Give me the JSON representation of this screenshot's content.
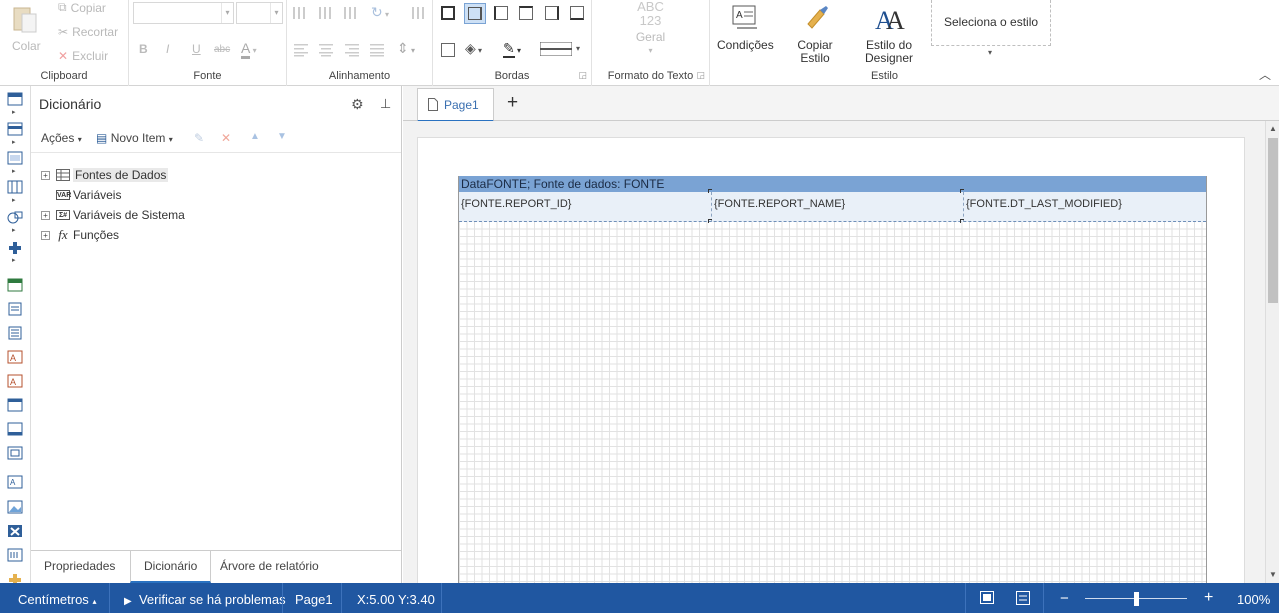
{
  "ribbon": {
    "clipboard": {
      "paste": "Colar",
      "copy": "Copiar",
      "cut": "Recortar",
      "delete": "Excluir",
      "group_label": "Clipboard"
    },
    "font": {
      "group_label": "Fonte",
      "bold": "B",
      "italic": "I",
      "underline": "U",
      "strike": "abc"
    },
    "alignment": {
      "group_label": "Alinhamento"
    },
    "borders": {
      "group_label": "Bordas"
    },
    "text_format": {
      "abc": "ABC",
      "num": "123",
      "general": "Geral",
      "group_label": "Formato do Texto"
    },
    "style": {
      "conditions": "Condições",
      "copy_style": "Copiar Estilo",
      "designer_style_line1": "Estilo do",
      "designer_style_line2": "Designer",
      "select_style": "Seleciona o estilo",
      "group_label": "Estilo"
    }
  },
  "dictionary": {
    "title": "Dicionário",
    "toolbar": {
      "actions": "Ações",
      "new_item": "Novo Item"
    },
    "tree": [
      {
        "label": "Fontes de Dados",
        "expandable": true,
        "icon": "datasource-icon"
      },
      {
        "label": "Variáveis",
        "expandable": false,
        "icon": "variables-icon"
      },
      {
        "label": "Variáveis de Sistema",
        "expandable": true,
        "icon": "system-variables-icon"
      },
      {
        "label": "Funções",
        "expandable": true,
        "icon": "functions-icon"
      }
    ],
    "tabs": [
      "Propriedades",
      "Dicionário",
      "Árvore de relatório"
    ],
    "active_tab": 1
  },
  "pages": {
    "tab_label": "Page1"
  },
  "report": {
    "band_header": "DataFONTE; Fonte de dados: FONTE",
    "cells": [
      "{FONTE.REPORT_ID}",
      "{FONTE.REPORT_NAME}",
      "{FONTE.DT_LAST_MODIFIED}"
    ]
  },
  "statusbar": {
    "units": "Centímetros",
    "check": "Verificar se há problemas",
    "page": "Page1",
    "coords": "X:5.00 Y:3.40",
    "zoom_minus": "−",
    "zoom_plus": "+",
    "zoom": "100%",
    "zoom_level": 0.5
  },
  "colors": {
    "accent": "#2057a1",
    "band": "#7aa3d4",
    "tab_underline": "#2a72c1"
  }
}
